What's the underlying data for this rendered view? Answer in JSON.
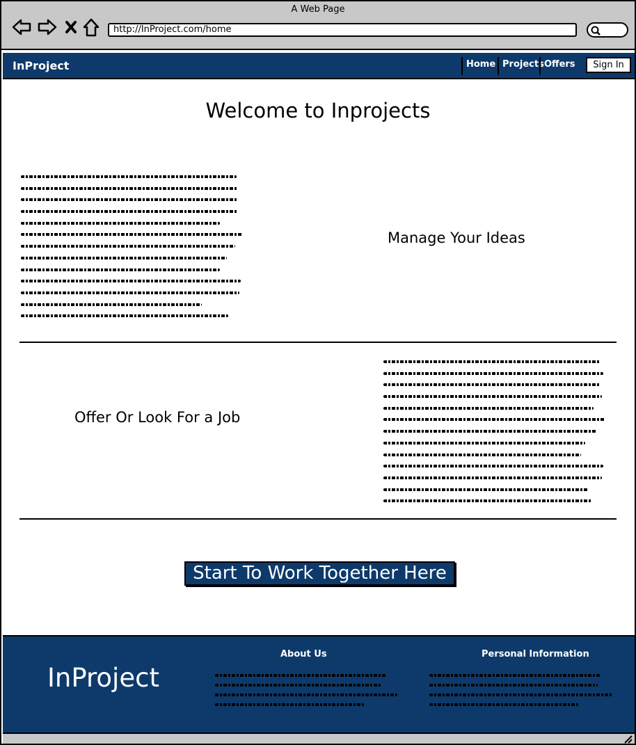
{
  "window": {
    "title": "A Web Page",
    "url": "http://InProject.com/home"
  },
  "navbar": {
    "brand": "InProject",
    "items": [
      {
        "label": "Home"
      },
      {
        "label": "Projects"
      },
      {
        "label": "Offers"
      }
    ],
    "sign_in": "Sign In"
  },
  "main": {
    "heading": "Welcome to Inprojects",
    "feature1_title": "Manage Your Ideas",
    "feature2_title": "Offer Or Look For a Job",
    "cta": "Start To Work Together Here"
  },
  "footer": {
    "brand": "InProject",
    "about_heading": "About Us",
    "personal_heading": "Personal Information"
  },
  "colors": {
    "brand_blue": "#0d3a6b",
    "chrome_gray": "#c8c8c8"
  }
}
